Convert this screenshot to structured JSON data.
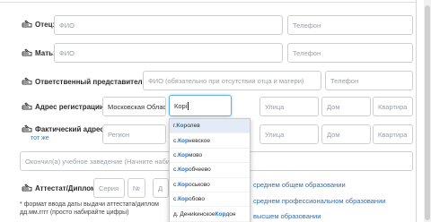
{
  "rows": {
    "father": {
      "label": "Отец:",
      "fio_placeholder": "ФИО",
      "phone_placeholder": "Телефон"
    },
    "mother": {
      "label": "Мать:",
      "fio_placeholder": "ФИО",
      "phone_placeholder": "Телефон"
    },
    "guardian": {
      "label": "Ответственный представитель:",
      "fio_placeholder": "ФИО (обязательно при отсутствии отца и матери)",
      "phone_placeholder": "Телефон"
    },
    "registration": {
      "label": "Адрес регистрации:",
      "region_value": "Московская Облас",
      "city_value": "Корі",
      "street_placeholder": "Улица",
      "house_placeholder": "Дом",
      "apartment_placeholder": "Квартира"
    },
    "actual": {
      "label": "Фактический адрес:",
      "same_link": "тот же",
      "region_placeholder": "Регион",
      "street_placeholder": "Улица",
      "house_placeholder": "Дом",
      "apartment_placeholder": "Квартира"
    },
    "school": {
      "placeholder": "Окончил(а) учебное заведение (Начните набира"
    },
    "certificate": {
      "label": "Аттестат/Диплом:",
      "series_placeholder": "Серия",
      "number_placeholder": "№",
      "date_placeholder": "Д"
    }
  },
  "note": {
    "line1": "* формат ввода даты выдачи аттестата/диплом",
    "line2": "дд.мм.гггг (просто набирайте цифры)"
  },
  "education_options": [
    "среднем общем образовании",
    "среднем профессиональном образовании",
    "высшем образовании"
  ],
  "dropdown": [
    {
      "prefix": "г. ",
      "hl": "Кор",
      "rest": "олев",
      "selected": true
    },
    {
      "prefix": "с. ",
      "hl": "Кор",
      "rest": "невское",
      "selected": false
    },
    {
      "prefix": "с. ",
      "hl": "Кор",
      "rest": "мово",
      "selected": false
    },
    {
      "prefix": "с. ",
      "hl": "Кор",
      "rest": "обчеево",
      "selected": false
    },
    {
      "prefix": "с. ",
      "hl": "Кор",
      "rest": "оськово",
      "selected": false
    },
    {
      "prefix": "с. ",
      "hl": "Кор",
      "rest": "обово",
      "selected": false
    },
    {
      "prefix": "д. Дениkинское ",
      "hl": "Кор",
      "rest": "дон",
      "selected": false
    }
  ],
  "colors": {
    "link": "#3a7cc4",
    "focus_border": "#66afe9",
    "highlight": "#2e6fb7",
    "selected_bg": "#e3ecf6"
  }
}
